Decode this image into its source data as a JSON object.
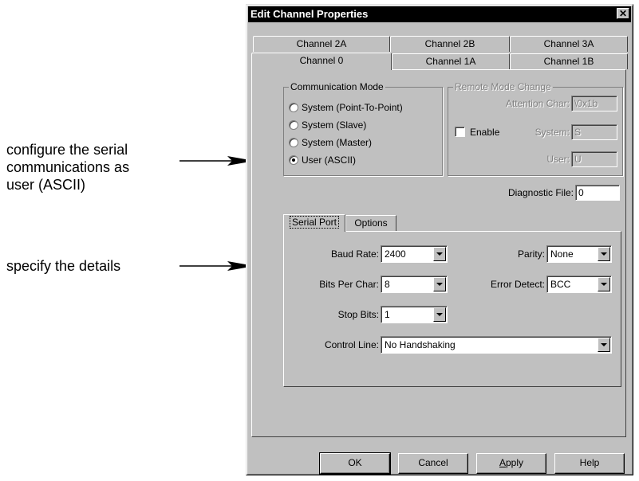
{
  "annotations": {
    "configure_lines": [
      "configure the serial",
      "communications as",
      "user (ASCII)"
    ],
    "specify": "specify the details"
  },
  "dialog": {
    "title": "Edit Channel Properties",
    "close_glyph": "✕",
    "tabs_back": [
      "Channel 2A",
      "Channel 2B",
      "Channel 3A"
    ],
    "tabs_front": [
      "Channel 0",
      "Channel 1A",
      "Channel 1B"
    ],
    "active_tab": "Channel 0",
    "communication_mode": {
      "title": "Communication Mode",
      "options": [
        "System (Point-To-Point)",
        "System (Slave)",
        "System (Master)",
        "User (ASCII)"
      ],
      "selected": "User (ASCII)"
    },
    "remote_mode": {
      "title": "Remote Mode Change",
      "enable_label": "Enable",
      "enabled": false,
      "attention_char_label": "Attention Char:",
      "attention_char_value": "\\0x1b",
      "system_label": "System:",
      "system_value": "S",
      "user_label": "User:",
      "user_value": "U"
    },
    "diagnostic_file": {
      "label": "Diagnostic File:",
      "value": "0"
    },
    "inner_tabs": [
      "Serial Port",
      "Options"
    ],
    "active_inner_tab": "Serial Port",
    "serial_port": {
      "baud_rate": {
        "label": "Baud Rate:",
        "value": "2400"
      },
      "parity": {
        "label": "Parity:",
        "value": "None"
      },
      "bits_per_char": {
        "label": "Bits Per Char:",
        "value": "8"
      },
      "error_detect": {
        "label": "Error Detect:",
        "value": "BCC"
      },
      "stop_bits": {
        "label": "Stop Bits:",
        "value": "1"
      },
      "control_line": {
        "label": "Control Line:",
        "value": "No Handshaking"
      }
    },
    "buttons": {
      "ok": "OK",
      "cancel": "Cancel",
      "apply_prefix": "A",
      "apply_rest": "pply",
      "help": "Help"
    }
  }
}
